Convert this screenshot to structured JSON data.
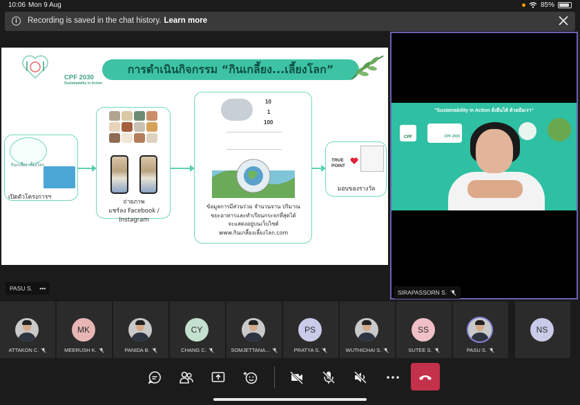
{
  "status_bar": {
    "time": "10:06",
    "date": "Mon 9 Aug",
    "battery": "85%"
  },
  "banner": {
    "message": "Recording is saved in the chat history.",
    "link": "Learn more"
  },
  "slide": {
    "title": "การดำเนินกิจกรรม “กินเกลี้ยง...เลี้ยงโลก”",
    "brand": "CPF 2030",
    "brand_sub": "Sustainability in Action",
    "step1_label": "เปิดตัวโครงการฯ",
    "step1_logo": "กินเกลี้ยง เลี้ยงโลก",
    "step2_label": "ถ่ายภาพ\nแชร์ลง Facebook /\nInstagram",
    "step3_label": "ข้อมูลการมีส่วนร่วม จำนวนจาน ปริมาณ\nขยะอาหารและทำเรียนกระจกที่สุดได้\nจะแสดงอยู่บนเว็บไซต์\nwww.กินเกลี้ยงเลี้ยงโลก.com",
    "step4_label": "มอบของรางวัล",
    "truepoint": "TRUE POINT",
    "stat1": "10",
    "stat2": "1",
    "stat3": "100",
    "presenter": "PASU S."
  },
  "video": {
    "heading": "\"Sustainability in Action ยั่งยืนได้ ด้วยมือเรา\"",
    "cpf": "CPF",
    "cpf2030": "CPF 2030",
    "name": "SIRAPASSORN S."
  },
  "participants": [
    {
      "name": "ATTAKON C.",
      "initials": "",
      "photo": true,
      "bg": ""
    },
    {
      "name": "MEERUSH K.",
      "initials": "MK",
      "photo": false,
      "bg": "#e8b5b5"
    },
    {
      "name": "PANIDA B.",
      "initials": "",
      "photo": true,
      "bg": ""
    },
    {
      "name": "CHANG C.",
      "initials": "CY",
      "photo": false,
      "bg": "#c4e0cf"
    },
    {
      "name": "SOMJETTANA...",
      "initials": "",
      "photo": true,
      "bg": ""
    },
    {
      "name": "PRATYA S.",
      "initials": "PS",
      "photo": false,
      "bg": "#c9cbe9"
    },
    {
      "name": "WUTHICHAI S.",
      "initials": "",
      "photo": true,
      "bg": ""
    },
    {
      "name": "SUTEE S.",
      "initials": "SS",
      "photo": false,
      "bg": "#f0c0c6"
    },
    {
      "name": "PASU S.",
      "initials": "",
      "photo": true,
      "bg": ""
    },
    {
      "name": "NS",
      "initials": "NS",
      "photo": false,
      "bg": "#c9cbe9"
    }
  ],
  "controls": [
    "chat",
    "participants",
    "share",
    "reactions",
    "camera-off",
    "mic-off",
    "speaker-off",
    "more",
    "leave"
  ],
  "colors": {
    "accent": "#6a63b7",
    "hangup": "#c4314b",
    "teal": "#3dc3a4"
  }
}
